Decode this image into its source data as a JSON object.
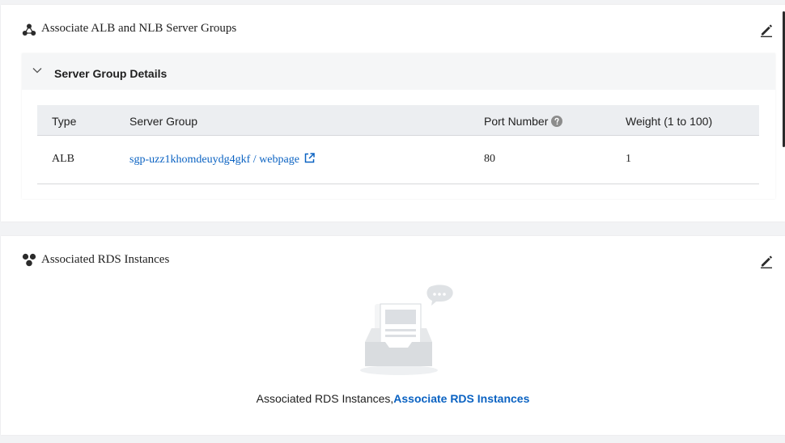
{
  "alb_section": {
    "title": "Associate ALB and NLB Server Groups",
    "panel": {
      "title": "Server Group Details",
      "columns": {
        "type": "Type",
        "server_group": "Server Group",
        "port_number": "Port Number",
        "weight": "Weight (1 to 100)"
      },
      "rows": [
        {
          "type": "ALB",
          "server_group": "sgp-uzz1khomdeuydg4gkf / webpage",
          "port_number": "80",
          "weight": "1"
        }
      ]
    }
  },
  "rds_section": {
    "title": "Associated RDS Instances",
    "empty_text": "Associated RDS Instances,",
    "empty_link": "Associate RDS Instances"
  },
  "colors": {
    "link": "#0a62c2",
    "header_bg": "#eceef1",
    "panel_head_bg": "#f5f6f7"
  },
  "icons": {
    "alb_title": "cluster-icon",
    "rds_title": "instances-icon",
    "edit": "edit-pencil-icon",
    "collapse": "chevron-down-icon",
    "help": "question-circle-icon",
    "external": "external-link-icon"
  }
}
